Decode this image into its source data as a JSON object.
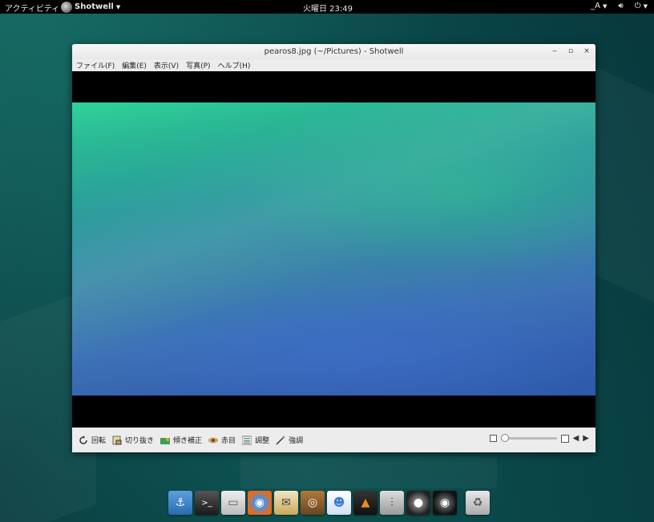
{
  "topbar": {
    "activities": "アクティビティ",
    "app_name": "Shotwell",
    "clock": "火曜日 23:49",
    "input_method": "A",
    "volume_icon": "volume-icon",
    "power_icon": "power-icon"
  },
  "window": {
    "title": "pearos8.jpg (~/Pictures) - Shotwell",
    "controls": [
      "minimize",
      "maximize",
      "close"
    ]
  },
  "menubar": {
    "items": [
      "ファイル(F)",
      "編集(E)",
      "表示(V)",
      "写真(P)",
      "ヘルプ(H)"
    ]
  },
  "toolbar": {
    "tools": [
      {
        "label": "回転",
        "icon": "rotate-icon"
      },
      {
        "label": "切り抜き",
        "icon": "crop-icon"
      },
      {
        "label": "傾き補正",
        "icon": "straighten-icon"
      },
      {
        "label": "赤目",
        "icon": "redeye-icon"
      },
      {
        "label": "調整",
        "icon": "adjust-icon"
      },
      {
        "label": "強調",
        "icon": "enhance-icon"
      }
    ],
    "zoom_level": 0.0
  },
  "dock": {
    "items": [
      "anchor",
      "terminal",
      "files",
      "firefox",
      "mail",
      "speaker",
      "messages",
      "vlc",
      "mixer",
      "dvd",
      "camera",
      "trash"
    ]
  },
  "colors": {
    "topbar_bg": "#000000",
    "window_bg": "#ececec",
    "photo_top": "#2fd39a",
    "photo_bottom": "#2c5aa8"
  }
}
